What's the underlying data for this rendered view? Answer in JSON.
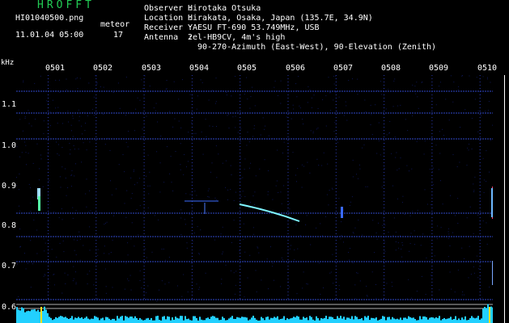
{
  "logo": "HROFFT",
  "filename": "HI01040500.png",
  "datetime": "11.01.04 05:00",
  "meteor_label": "meteor",
  "meteor_count": "17",
  "header": {
    "observer_label": "Observer :",
    "observer_value": "Hirotaka Otsuka",
    "location_label": "Location :",
    "location_value": "Hirakata, Osaka, Japan (135.7E, 34.9N)",
    "receiver_label": "Receiver :",
    "receiver_value": "YAESU FT-690 53.749MHz, USB",
    "antenna_label": "Antenna  :",
    "antenna_value": "2el-HB9CV, 4m's high",
    "antenna_value2": "90-270-Azimuth (East-West), 90-Elevation (Zenith)"
  },
  "colors": {
    "logo": "#22cc55",
    "background": "#000000",
    "noise": "#1a2a9a",
    "histogram": "#22d0ff"
  },
  "chart_data": {
    "type": "heatmap",
    "ylabel_unit": "kHz",
    "y_ticks": [
      "1.1",
      "1.0",
      "0.9",
      "0.8",
      "0.7",
      "0.6"
    ],
    "x_ticks": [
      "0501",
      "0502",
      "0503",
      "0504",
      "0505",
      "0506",
      "0507",
      "0508",
      "0509",
      "0510"
    ],
    "xlim": [
      "05:00",
      "05:10"
    ],
    "ylim": [
      0.6,
      1.15
    ],
    "grid": true
  }
}
